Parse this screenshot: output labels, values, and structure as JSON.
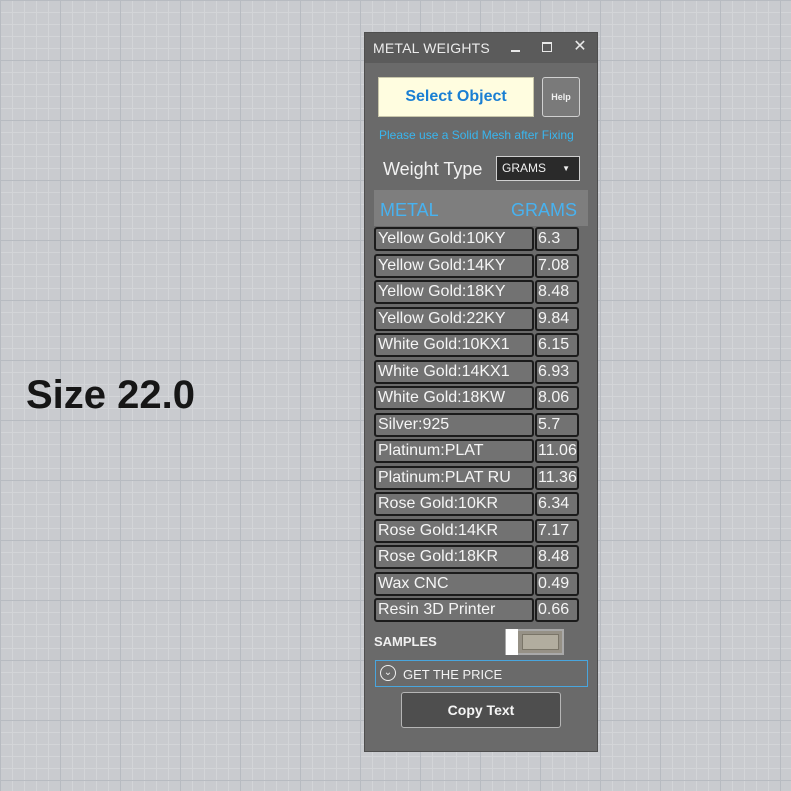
{
  "viewport": {
    "label": "Size 22.0"
  },
  "window": {
    "title": "METAL WEIGHTS",
    "controls": {
      "minimize": "minimize-icon",
      "maximize": "maximize-icon",
      "close": "✕"
    }
  },
  "actions": {
    "select_object": "Select Object",
    "help": "Help",
    "hint": "Please use a Solid Mesh after Fixing"
  },
  "weight_type": {
    "label": "Weight Type",
    "selected": "GRAMS"
  },
  "table": {
    "headers": {
      "metal": "METAL",
      "unit": "GRAMS"
    },
    "rows": [
      {
        "metal": "Yellow Gold:10KY",
        "weight": "6.3"
      },
      {
        "metal": "Yellow Gold:14KY",
        "weight": "7.08"
      },
      {
        "metal": "Yellow Gold:18KY",
        "weight": "8.48"
      },
      {
        "metal": "Yellow Gold:22KY",
        "weight": "9.84"
      },
      {
        "metal": "White Gold:10KX1",
        "weight": "6.15"
      },
      {
        "metal": "White Gold:14KX1",
        "weight": "6.93"
      },
      {
        "metal": "White Gold:18KW",
        "weight": "8.06"
      },
      {
        "metal": "Silver:925",
        "weight": "5.7"
      },
      {
        "metal": "Platinum:PLAT",
        "weight": "11.06"
      },
      {
        "metal": "Platinum:PLAT RU",
        "weight": "11.36"
      },
      {
        "metal": "Rose Gold:10KR",
        "weight": "6.34"
      },
      {
        "metal": "Rose Gold:14KR",
        "weight": "7.17"
      },
      {
        "metal": "Rose Gold:18KR",
        "weight": "8.48"
      },
      {
        "metal": "Wax  CNC",
        "weight": "0.49"
      },
      {
        "metal": "Resin 3D Printer",
        "weight": "0.66"
      }
    ]
  },
  "samples": {
    "label": "SAMPLES",
    "enabled": false
  },
  "price": {
    "label": "GET THE PRICE",
    "icon": "chevron-down-circle-icon"
  },
  "copy": {
    "label": "Copy Text"
  },
  "colors": {
    "accent": "#39b6ef",
    "panel": "#6a6a6a",
    "select_bg": "#fffde0"
  }
}
